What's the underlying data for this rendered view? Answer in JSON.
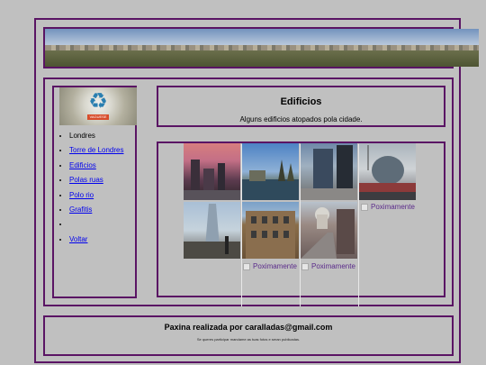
{
  "header": {
    "banner_alt": "London skyline panorama"
  },
  "sidebar": {
    "logo_icon": "recycle-icon",
    "logo_tag": "VAGUESE",
    "items": [
      {
        "label": "Londres",
        "link": false
      },
      {
        "label": "Torre de Londres",
        "link": true
      },
      {
        "label": "Edificios",
        "link": true
      },
      {
        "label": "Polas ruas",
        "link": true
      },
      {
        "label": "Polo rio",
        "link": true
      },
      {
        "label": "Grafitis",
        "link": true
      },
      {
        "label": "",
        "link": false
      },
      {
        "label": "Voltar",
        "link": true
      }
    ]
  },
  "main": {
    "title": "Edificios",
    "subtitle": "Alguns edificios atopados pola cidade.",
    "broken_label": "Poximamente"
  },
  "footer": {
    "line1": "Paxina realizada por caralladas@gmail.com",
    "line2": "Se queres participar mandame as tuas fotos e seran publicadas."
  },
  "colors": {
    "background": "#c0c0c0",
    "border": "#5a1464",
    "link": "#0000ee"
  }
}
